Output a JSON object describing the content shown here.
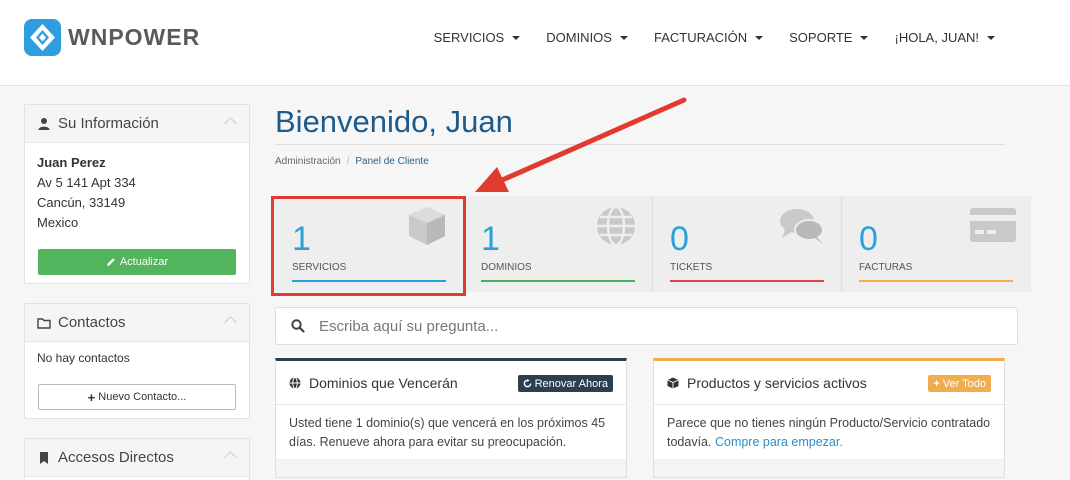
{
  "brand": {
    "name": "WNPOWER"
  },
  "nav": {
    "items": [
      {
        "label": "SERVICIOS"
      },
      {
        "label": "DOMINIOS"
      },
      {
        "label": "FACTURACIÓN"
      },
      {
        "label": "SOPORTE"
      },
      {
        "label": "¡HOLA, JUAN!"
      }
    ]
  },
  "sidebar": {
    "info": {
      "title": "Su Información",
      "icon": "user-icon",
      "name": "Juan Perez",
      "address1": "Av 5 141 Apt 334",
      "address2": "Cancún, 33149",
      "country": "Mexico",
      "update_label": "Actualizar"
    },
    "contacts": {
      "title": "Contactos",
      "icon": "folder-icon",
      "empty_text": "No hay contactos",
      "new_label": "Nuevo Contacto..."
    },
    "shortcuts": {
      "title": "Accesos Directos",
      "icon": "bookmark-icon"
    }
  },
  "main": {
    "title": "Bienvenido, Juan",
    "breadcrumb": [
      {
        "label": "Administración"
      },
      {
        "label": "Panel de Cliente"
      }
    ],
    "stats": [
      {
        "count": "1",
        "label": "SERVICIOS",
        "icon": "cube-icon",
        "color": "#2aa0d8"
      },
      {
        "count": "1",
        "label": "DOMINIOS",
        "icon": "globe-icon",
        "color": "#46b253"
      },
      {
        "count": "0",
        "label": "TICKETS",
        "icon": "comments-icon",
        "color": "#e0454d"
      },
      {
        "count": "0",
        "label": "FACTURAS",
        "icon": "credit-card-icon",
        "color": "#f0ad4e"
      }
    ],
    "search": {
      "placeholder": "Escriba aquí su pregunta..."
    },
    "domains_card": {
      "title": "Dominios que Vencerán",
      "button": "Renovar Ahora",
      "text": "Usted tiene 1 dominio(s) que vencerá en los próximos 45 días. Renueve ahora para evitar su preocupación.",
      "accent": "#2c3e50"
    },
    "products_card": {
      "title": "Productos y servicios activos",
      "button": "Ver Todo",
      "text": "Parece que no tienes ningún Producto/Servicio contratado todavía.",
      "link": "Compre para empezar.",
      "accent": "#f0ad4e"
    }
  }
}
